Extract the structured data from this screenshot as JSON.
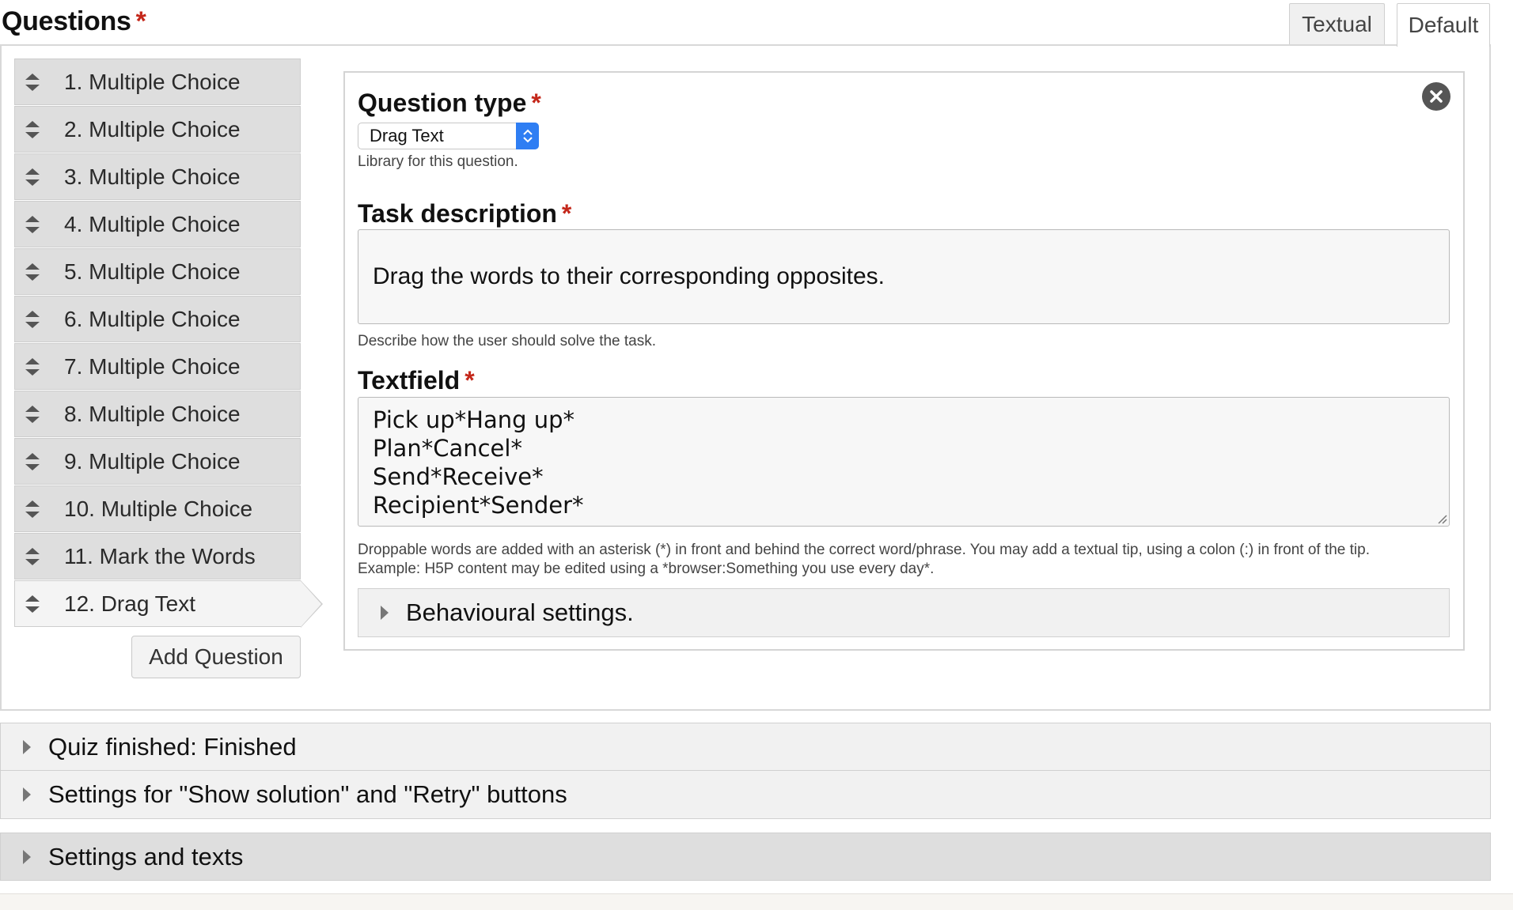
{
  "header": {
    "title": "Questions",
    "required_mark": "*",
    "tabs": [
      {
        "label": "Textual"
      },
      {
        "label": "Default"
      }
    ]
  },
  "questions": [
    {
      "label": "1. Multiple Choice"
    },
    {
      "label": "2. Multiple Choice"
    },
    {
      "label": "3. Multiple Choice"
    },
    {
      "label": "4. Multiple Choice"
    },
    {
      "label": "5. Multiple Choice"
    },
    {
      "label": "6. Multiple Choice"
    },
    {
      "label": "7. Multiple Choice"
    },
    {
      "label": "8. Multiple Choice"
    },
    {
      "label": "9. Multiple Choice"
    },
    {
      "label": "10. Multiple Choice"
    },
    {
      "label": "11. Mark the Words"
    },
    {
      "label": "12. Drag Text"
    }
  ],
  "active_question_index": 11,
  "add_question_label": "Add Question",
  "editor": {
    "question_type": {
      "label": "Question type",
      "value": "Drag Text",
      "help": "Library for this question."
    },
    "task_description": {
      "label": "Task description",
      "value": "Drag the words to their corresponding opposites.",
      "help": "Describe how the user should solve the task."
    },
    "textfield": {
      "label": "Textfield",
      "lines": [
        "Pick up*Hang up*",
        "Plan*Cancel*",
        "Send*Receive*",
        "Recipient*Sender*"
      ],
      "help_line1": "Droppable words are added with an asterisk (*) in front and behind the correct word/phrase. You may add a textual tip, using a colon (:) in front of the tip.",
      "help_line2": "Example: H5P content may be edited using a *browser:Something you use every day*."
    },
    "behavioural_settings": "Behavioural settings."
  },
  "sections": [
    {
      "label": "Quiz finished: Finished"
    },
    {
      "label": "Settings for \"Show solution\" and \"Retry\" buttons"
    },
    {
      "label": "Settings and texts"
    }
  ],
  "colors": {
    "required": "#c4271a",
    "select_accent": "#2f7ef3",
    "list_item_bg": "#dedede",
    "active_item_bg": "#f4f4f4"
  }
}
